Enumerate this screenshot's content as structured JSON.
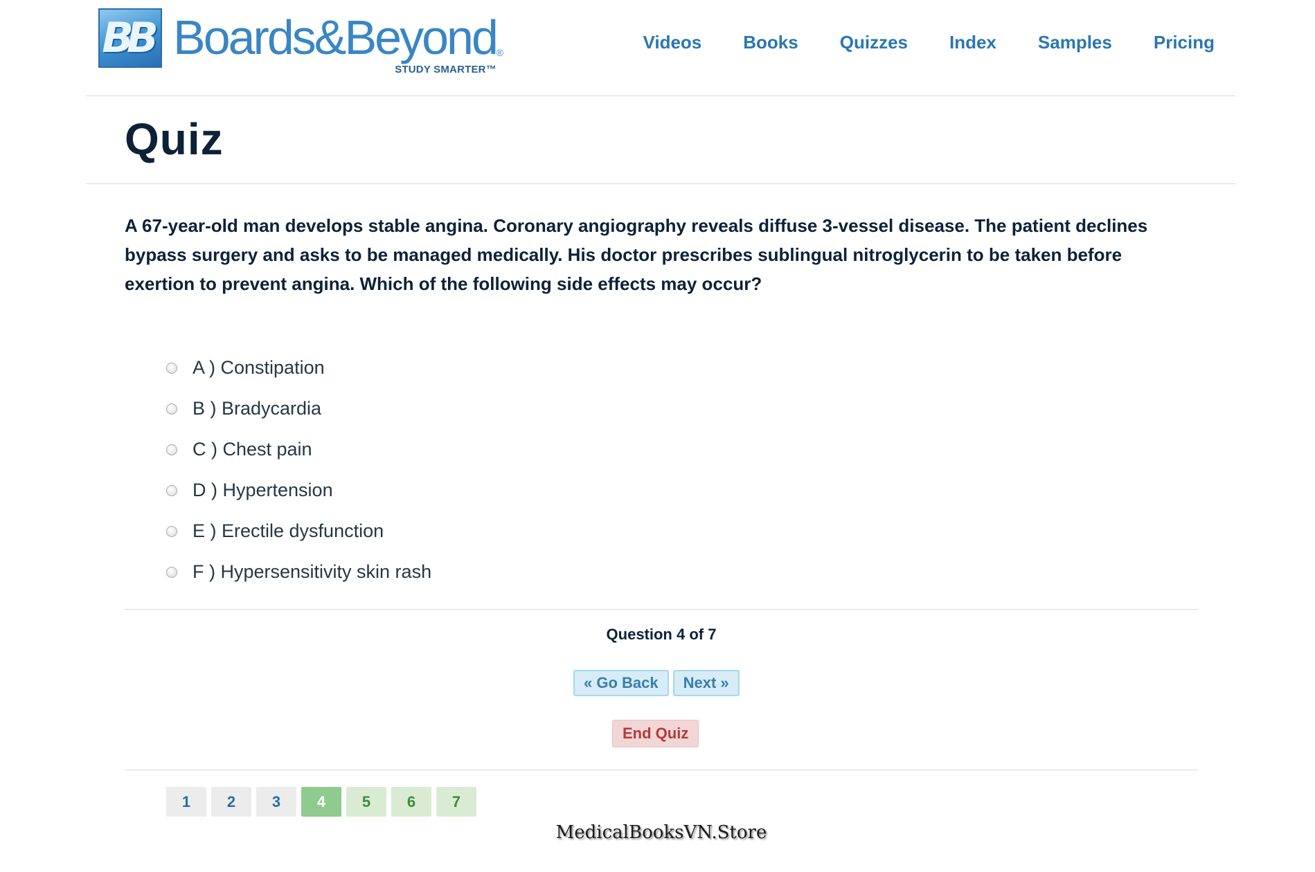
{
  "header": {
    "logo_mark": "BB",
    "logo_word": "Boards&Beyond",
    "logo_reg": "®",
    "logo_tagline": "STUDY SMARTER™",
    "nav": [
      {
        "label": "Videos"
      },
      {
        "label": "Books"
      },
      {
        "label": "Quizzes"
      },
      {
        "label": "Index"
      },
      {
        "label": "Samples"
      },
      {
        "label": "Pricing"
      }
    ]
  },
  "page": {
    "title": "Quiz"
  },
  "question": {
    "text": "A 67-year-old man develops stable angina. Coronary angiography reveals diffuse 3-vessel disease. The patient declines bypass surgery and asks to be managed medically. His doctor prescribes sublingual nitroglycerin to be taken before exertion to prevent angina. Which of the following side effects may occur?",
    "answers": [
      {
        "label": "A ) Constipation"
      },
      {
        "label": "B ) Bradycardia"
      },
      {
        "label": "C ) Chest pain"
      },
      {
        "label": "D ) Hypertension"
      },
      {
        "label": "E ) Erectile dysfunction"
      },
      {
        "label": "F ) Hypersensitivity skin rash"
      }
    ]
  },
  "controls": {
    "counter": "Question 4 of 7",
    "go_back": "« Go Back",
    "next": "Next »",
    "end_quiz": "End Quiz"
  },
  "pager": {
    "pages": [
      {
        "label": "1",
        "state": "done"
      },
      {
        "label": "2",
        "state": "done"
      },
      {
        "label": "3",
        "state": "done"
      },
      {
        "label": "4",
        "state": "current"
      },
      {
        "label": "5",
        "state": "todo"
      },
      {
        "label": "6",
        "state": "todo"
      },
      {
        "label": "7",
        "state": "todo"
      }
    ]
  },
  "watermark": "MedicalBooksVN.Store",
  "colors": {
    "nav_link": "#2a76b2",
    "title": "#0d2237",
    "button_blue_bg": "#d6ecf6",
    "end_quiz_bg": "#f2d6d6",
    "end_quiz_text": "#b33a3a",
    "page_current": "#8fcb8f",
    "page_todo": "#d9ecd3"
  }
}
